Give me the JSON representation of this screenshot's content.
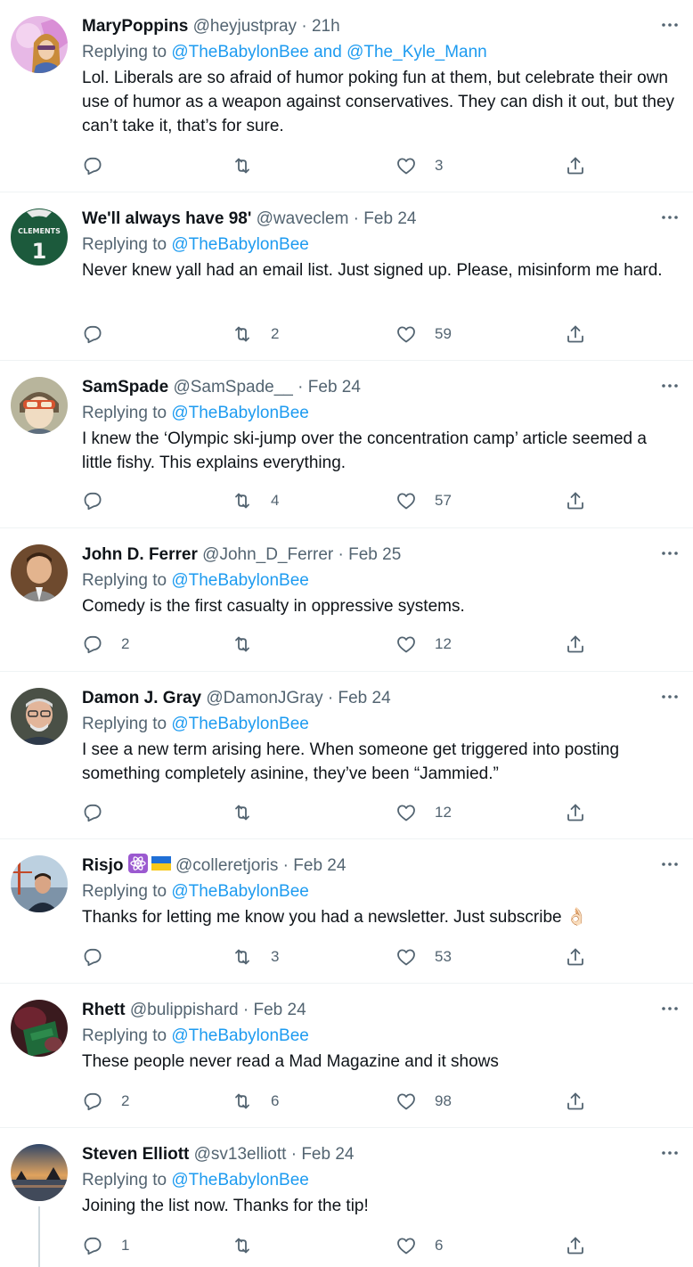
{
  "tweets": [
    {
      "name": "MaryPoppins",
      "handle": "@heyjustpray",
      "time": "21h",
      "replying_prefix": "Replying to ",
      "replying_to": "@TheBabylonBee and @The_Kyle_Mann",
      "text": "Lol.  Liberals are so afraid of humor poking fun at them, but celebrate their own use of humor as a weapon against conservatives.  They can dish it out, but they can’t take it, that’s for sure.",
      "replies": "",
      "retweets": "",
      "likes": "3"
    },
    {
      "name": "We'll always have 98'",
      "handle": "@waveclem",
      "time": "Feb 24",
      "replying_prefix": "Replying to ",
      "replying_to": "@TheBabylonBee",
      "text": "Never knew yall had an email list. Just signed up. Please, misinform me hard.",
      "replies": "",
      "retweets": "2",
      "likes": "59",
      "avatar_text": "CLEMENTS",
      "avatar_number": "1"
    },
    {
      "name": "SamSpade",
      "handle": "@SamSpade__",
      "time": "Feb 24",
      "replying_prefix": "Replying to ",
      "replying_to": "@TheBabylonBee",
      "text": "I knew the ‘Olympic ski-jump over the concentration camp’ article seemed a little fishy. This explains everything.",
      "replies": "",
      "retweets": "4",
      "likes": "57"
    },
    {
      "name": "John D. Ferrer",
      "handle": "@John_D_Ferrer",
      "time": "Feb 25",
      "replying_prefix": "Replying to ",
      "replying_to": "@TheBabylonBee",
      "text": "Comedy is the first casualty in oppressive systems.",
      "replies": "2",
      "retweets": "",
      "likes": "12"
    },
    {
      "name": "Damon J. Gray",
      "handle": "@DamonJGray",
      "time": "Feb 24",
      "replying_prefix": "Replying to ",
      "replying_to": "@TheBabylonBee",
      "text": "I see a new term arising here. When someone get triggered into posting something completely asinine, they’ve been “Jammied.”",
      "replies": "",
      "retweets": "",
      "likes": "12"
    },
    {
      "name": "Risjo",
      "name_badges": "⚛️🇺🇦",
      "handle": "@colleretjoris",
      "time": "Feb 24",
      "replying_prefix": "Replying to ",
      "replying_to": "@TheBabylonBee",
      "text": "Thanks for letting me know you had a newsletter. Just subscribe 👌🏻",
      "replies": "",
      "retweets": "3",
      "likes": "53"
    },
    {
      "name": "Rhett",
      "handle": "@bulippishard",
      "time": "Feb 24",
      "replying_prefix": "Replying to ",
      "replying_to": "@TheBabylonBee",
      "text": "These people never read a Mad Magazine and it shows",
      "replies": "2",
      "retweets": "6",
      "likes": "98"
    },
    {
      "name": "Steven Elliott",
      "handle": "@sv13elliott",
      "time": "Feb 24",
      "replying_prefix": "Replying to ",
      "replying_to": "@TheBabylonBee",
      "text": "Joining the list now.  Thanks for the tip!",
      "replies": "1",
      "retweets": "",
      "likes": "6"
    }
  ],
  "separator": " · ",
  "colors": {
    "accent": "#1d9bf0",
    "secondary_text": "#536471",
    "primary_text": "#0f1419",
    "divider": "#eff3f4"
  },
  "icons": {
    "reply": "reply-icon",
    "retweet": "retweet-icon",
    "like": "like-icon",
    "share": "share-icon",
    "more": "more-icon"
  }
}
